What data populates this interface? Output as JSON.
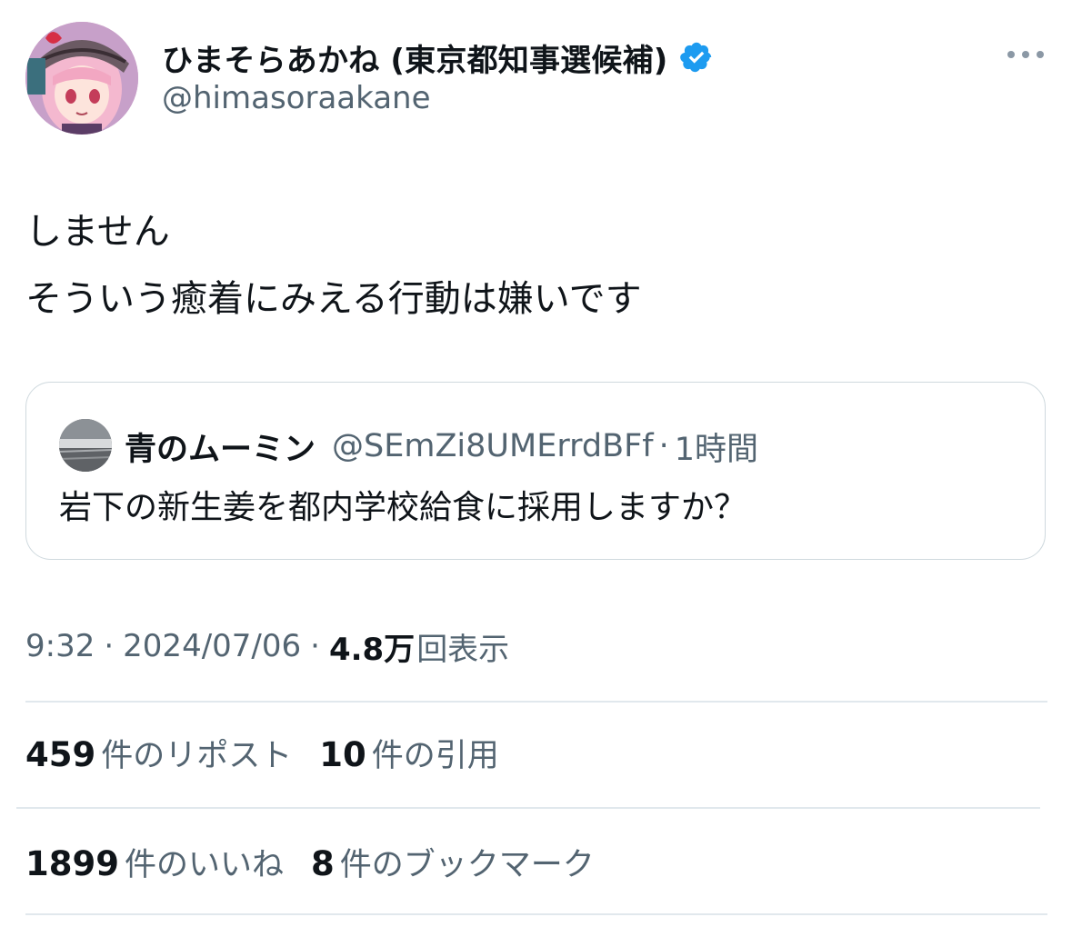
{
  "author": {
    "display_name": "ひまそらあかね (東京都知事選候補)",
    "handle": "@himasoraakane",
    "verified_badge_color": "#1d9bf0",
    "avatar_icon": "anime-avatar-icon"
  },
  "tweet": {
    "lines": [
      "しません",
      "そういう癒着にみえる行動は嫌いです"
    ]
  },
  "quote": {
    "name": "青のムーミン",
    "handle": "@SEmZi8UMErrdBFf",
    "separator": "·",
    "time": "1時間",
    "text": "岩下の新生姜を都内学校給食に採用しますか？"
  },
  "meta": {
    "time": "9:32",
    "separator": "·",
    "date": "2024/07/06",
    "views_count": "4.8万",
    "views_label": "回表示"
  },
  "stats": {
    "reposts_count": "459",
    "reposts_label": "件のリポスト",
    "quotes_count": "10",
    "quotes_label": "件の引用",
    "likes_count": "1899",
    "likes_label": "件のいいね",
    "bookmarks_count": "8",
    "bookmarks_label": "件のブックマーク"
  },
  "colors": {
    "text_primary": "#0f1419",
    "text_secondary": "#536471",
    "border": "#cfd9de",
    "divider": "#e1e8ed"
  }
}
